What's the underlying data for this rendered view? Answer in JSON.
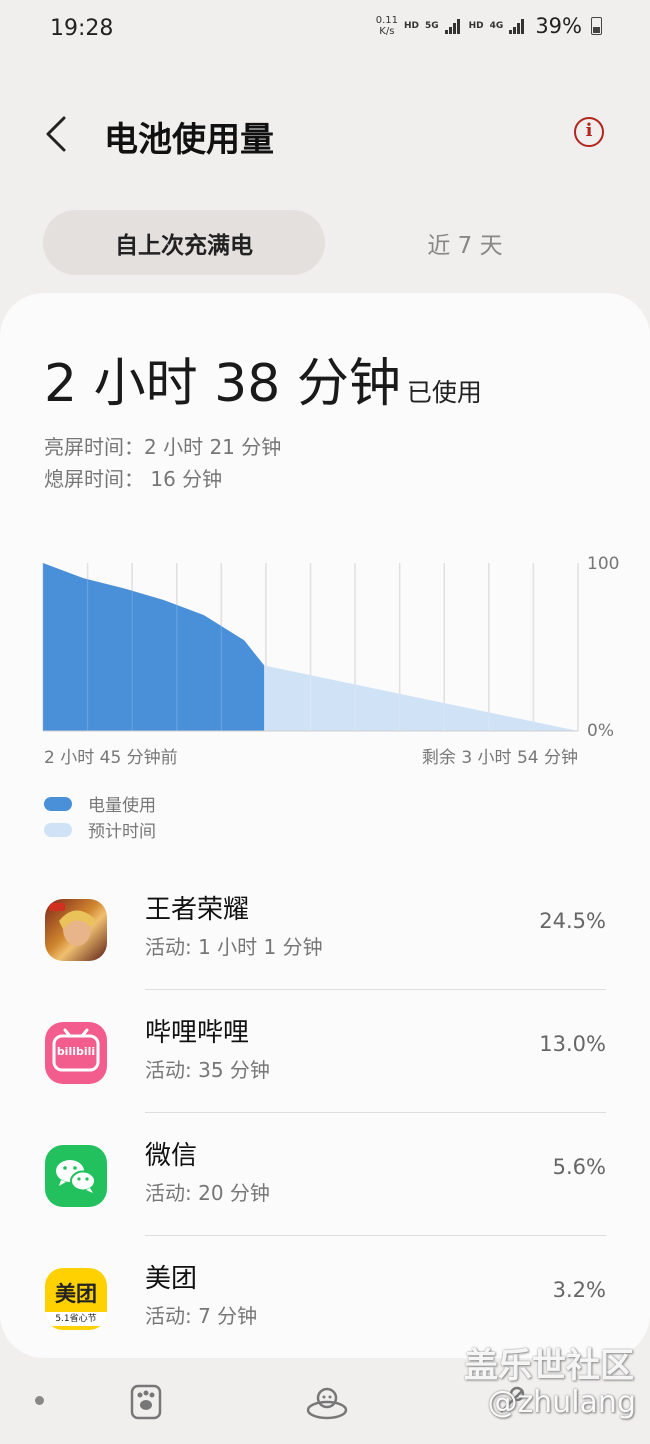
{
  "status": {
    "time": "19:28",
    "speed_value": "0.11",
    "speed_unit": "K/s",
    "hd1": "HD",
    "net1": "5G",
    "hd2": "HD",
    "net2": "4G",
    "battery": "39%"
  },
  "header": {
    "title": "电池使用量"
  },
  "tabs": {
    "active": "自上次充满电",
    "inactive": "近 7 天"
  },
  "summary": {
    "used_time": "2 小时 38 分钟",
    "used_label": "已使用",
    "screen_on": "亮屏时间：2 小时 21 分钟",
    "screen_off": "熄屏时间： 16 分钟"
  },
  "chart": {
    "y_max_label": "100",
    "y_min_label": "0%",
    "start_label": "2 小时 45 分钟前",
    "end_label": "剩余 3 小时 54 分钟",
    "usage_color": "#4a90d9",
    "forecast_color": "#cfe2f6"
  },
  "chart_data": {
    "type": "area",
    "ylim": [
      0,
      100
    ],
    "series": [
      {
        "name": "电量使用",
        "x": [
          0,
          0.5,
          1,
          1.5,
          2,
          2.5,
          2.75
        ],
        "values": [
          100,
          91,
          85,
          78,
          69,
          54,
          39
        ]
      },
      {
        "name": "预计时间",
        "x": [
          2.75,
          6.65
        ],
        "values": [
          39,
          0
        ]
      }
    ]
  },
  "legend": [
    {
      "label": "电量使用",
      "color": "#4a90d9"
    },
    {
      "label": "预计时间",
      "color": "#cfe2f6"
    }
  ],
  "apps": [
    {
      "name": "王者荣耀",
      "activity": "活动: 1 小时 1 分钟",
      "percent": "24.5%",
      "icon": "honor-of-kings-icon"
    },
    {
      "name": "哔哩哔哩",
      "activity": "活动: 35 分钟",
      "percent": "13.0%",
      "icon": "bilibili-icon",
      "icon_text": "bilibili"
    },
    {
      "name": "微信",
      "activity": "活动: 20 分钟",
      "percent": "5.6%",
      "icon": "wechat-icon"
    },
    {
      "name": "美团",
      "activity": "活动: 7 分钟",
      "percent": "3.2%",
      "icon": "meituan-icon",
      "icon_text": "美团",
      "icon_subtext": "5.1省心节"
    }
  ],
  "watermark": {
    "line1": "盖乐世社区",
    "line2": "@zhulang"
  }
}
